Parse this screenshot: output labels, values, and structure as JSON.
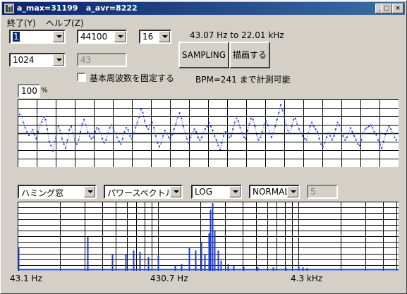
{
  "window": {
    "title": "a_max=31199   a_avr=8222"
  },
  "menu": [
    {
      "label": "終了(Y)"
    },
    {
      "label": "ヘルプ(Z)"
    }
  ],
  "controls": {
    "channel": "1",
    "rate": "44100",
    "bits": "16",
    "fft_size": "1024",
    "edit_43": "43",
    "freq_range": "43.07 Hz to 22.01 kHz",
    "sampling_button": "SAMPLING",
    "draw_button": "描画する",
    "fix_checkbox_label": "基本周波数を固定する",
    "bpm_text": "BPM=241 まで計測可能",
    "gain": "100",
    "gain_unit": "%",
    "window_fn": "ハミング窓",
    "spectrum_type": "パワースペクトル",
    "scale": "LOG",
    "mode": "NORMAL",
    "edit_5": "5"
  },
  "axis_labels": [
    "43.1 Hz",
    "430.7 Hz",
    "4.3 kHz"
  ],
  "colors": {
    "signal": "#1e3cd2",
    "titlebar": "#0a246a"
  },
  "waveform": [
    0.78,
    0.75,
    0.66,
    0.58,
    0.52,
    0.47,
    0.5,
    0.55,
    0.48,
    0.42,
    0.52,
    0.62,
    0.67,
    0.74,
    0.7,
    0.56,
    0.38,
    0.32,
    0.24,
    0.37,
    0.5,
    0.6,
    0.54,
    0.42,
    0.34,
    0.28,
    0.4,
    0.55,
    0.6,
    0.5,
    0.4,
    0.34,
    0.4,
    0.52,
    0.64,
    0.7,
    0.62,
    0.52,
    0.46,
    0.42,
    0.44,
    0.52,
    0.58,
    0.56,
    0.5,
    0.42,
    0.36,
    0.4,
    0.5,
    0.58,
    0.62,
    0.57,
    0.5,
    0.44,
    0.38,
    0.34,
    0.42,
    0.52,
    0.58,
    0.55,
    0.46,
    0.42,
    0.5,
    0.58,
    0.66,
    0.74,
    0.86,
    0.8,
    0.68,
    0.6,
    0.56,
    0.62,
    0.66,
    0.58,
    0.46,
    0.36,
    0.3,
    0.36,
    0.46,
    0.54,
    0.5,
    0.44,
    0.4,
    0.48,
    0.56,
    0.64,
    0.74,
    0.8,
    0.72,
    0.6,
    0.5,
    0.42,
    0.36,
    0.44,
    0.5,
    0.56,
    0.52,
    0.44,
    0.4,
    0.44,
    0.5,
    0.56,
    0.6,
    0.66,
    0.6,
    0.54,
    0.46,
    0.4,
    0.32,
    0.26,
    0.36,
    0.46,
    0.52,
    0.5,
    0.44,
    0.46,
    0.56,
    0.66,
    0.72,
    0.68,
    0.58,
    0.5,
    0.44,
    0.42,
    0.54,
    0.64,
    0.72,
    0.7,
    0.6,
    0.48,
    0.4,
    0.44,
    0.52,
    0.62,
    0.68,
    0.62,
    0.5,
    0.44,
    0.5,
    0.6,
    0.7,
    0.8,
    0.92,
    0.84,
    0.74,
    0.62,
    0.54,
    0.5,
    0.6,
    0.7,
    0.72,
    0.64,
    0.56,
    0.5,
    0.46,
    0.42,
    0.4,
    0.5,
    0.6,
    0.66,
    0.6,
    0.56,
    0.52,
    0.42,
    0.34,
    0.3,
    0.36,
    0.44,
    0.5,
    0.46,
    0.4,
    0.46,
    0.56,
    0.66,
    0.62,
    0.54,
    0.46,
    0.4,
    0.44,
    0.5,
    0.58,
    0.52,
    0.46,
    0.4,
    0.34,
    0.32,
    0.4,
    0.5,
    0.56,
    0.58,
    0.6,
    0.62,
    0.58,
    0.52,
    0.48,
    0.4,
    0.34,
    0.28,
    0.38,
    0.48,
    0.54,
    0.6,
    0.56,
    0.5,
    0.44,
    0.4
  ]
}
